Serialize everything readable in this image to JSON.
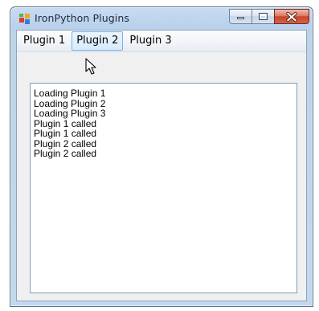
{
  "window": {
    "title": "IronPython Plugins",
    "icon": "winforms-app-icon"
  },
  "caption_buttons": [
    {
      "name": "minimize",
      "icon": "minimize-icon"
    },
    {
      "name": "maximize",
      "icon": "maximize-icon"
    },
    {
      "name": "close",
      "icon": "close-icon"
    }
  ],
  "menu": {
    "items": [
      "Plugin 1",
      "Plugin 2",
      "Plugin 3"
    ],
    "hovered": "Plugin 2"
  },
  "output": {
    "lines": [
      "Loading Plugin 1",
      "Loading Plugin 2",
      "Loading Plugin 3",
      "Plugin 1 called",
      "Plugin 1 called",
      "Plugin 2 called",
      "Plugin 2 called"
    ]
  },
  "colors": {
    "title_bar": "#c9dcf1",
    "close_button": "#c9432a",
    "menu_hover_border": "#7ab0e2",
    "textbox_border": "#7f9db9"
  }
}
